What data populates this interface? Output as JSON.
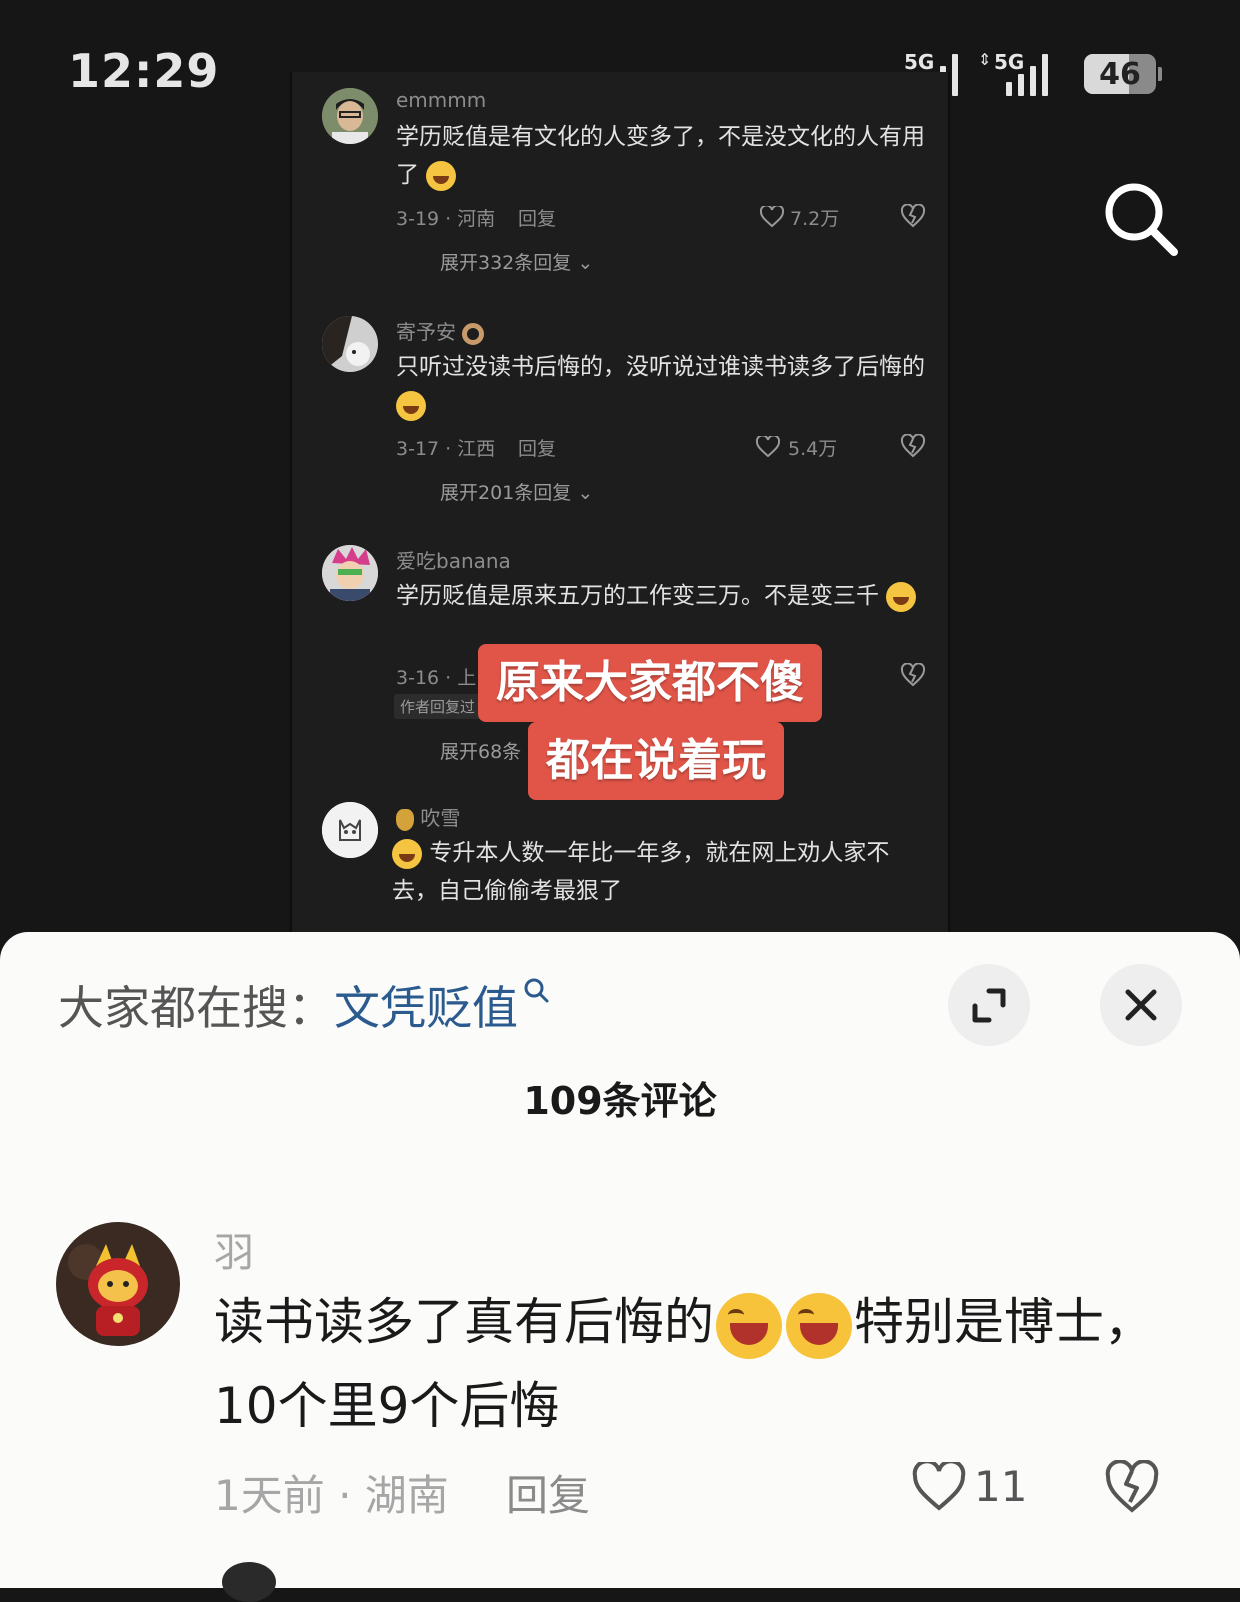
{
  "status_bar": {
    "time": "12:29",
    "signal1_label": "5G",
    "signal2_label": "5G",
    "battery": "46"
  },
  "embedded_comments": [
    {
      "name": "emmmm",
      "text": "学历贬值是有文化的人变多了，不是没文化的人有用了",
      "date_location": "3-19 · 河南",
      "reply": "回复",
      "likes": "7.2万",
      "expand": "展开332条回复"
    },
    {
      "name": "寄予安",
      "text": "只听过没读书后悔的，没听说过谁读书读多了后悔的",
      "date_location": "3-17 · 江西",
      "reply": "回复",
      "likes": "5.4万",
      "expand": "展开201条回复"
    },
    {
      "name": "爱吃banana",
      "text": "学历贬值是原来五万的工作变三万。不是变三千",
      "date_location": "3-16 · 上",
      "author_tag": "作者回复过",
      "expand": "展开68条"
    },
    {
      "name": "吹雪",
      "text": "专升本人数一年比一年多，就在网上劝人家不去，自己偷偷考最狠了"
    }
  ],
  "overlay_caption": {
    "line1": "原来大家都不傻",
    "line2": "都在说着玩"
  },
  "sheet": {
    "hot_search_label": "大家都在搜：",
    "hot_search_keyword": "文凭贬值",
    "comment_count": "109条评论",
    "comment": {
      "name": "羽",
      "text_part1": "读书读多了真有后悔的",
      "text_part2": "特别是博士，10个里9个后悔",
      "time_location": "1天前 · 湖南",
      "reply": "回复",
      "likes": "11"
    }
  },
  "colors": {
    "dark_bg": "#161616",
    "caption_red": "#e05548",
    "keyword_blue": "#2b5a8f",
    "sheet_bg": "#fbfbfa"
  },
  "icons": [
    "search-icon",
    "heart-icon",
    "broken-heart-icon",
    "expand-icon",
    "close-icon",
    "chevron-down-icon",
    "laugh-cry-emoji"
  ]
}
